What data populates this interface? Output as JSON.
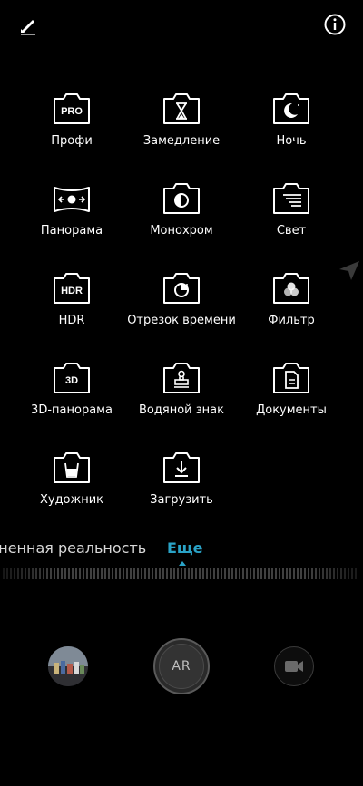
{
  "top_bar": {
    "edit_icon": "pencil-icon",
    "info_icon": "info-icon"
  },
  "modes": [
    {
      "label": "Профи",
      "icon": "pro-icon"
    },
    {
      "label": "Замедление",
      "icon": "hourglass-icon"
    },
    {
      "label": "Ночь",
      "icon": "night-icon"
    },
    {
      "label": "Панорама",
      "icon": "panorama-icon"
    },
    {
      "label": "Монохром",
      "icon": "monochrome-icon"
    },
    {
      "label": "Свет",
      "icon": "light-painting-icon"
    },
    {
      "label": "HDR",
      "icon": "hdr-icon"
    },
    {
      "label": "Отрезок времени",
      "icon": "timelapse-icon"
    },
    {
      "label": "Фильтр",
      "icon": "filter-icon"
    },
    {
      "label": "3D-панорама",
      "icon": "3d-panorama-icon"
    },
    {
      "label": "Водяной знак",
      "icon": "watermark-icon"
    },
    {
      "label": "Документы",
      "icon": "documents-icon"
    },
    {
      "label": "Художник",
      "icon": "artist-icon"
    },
    {
      "label": "Загрузить",
      "icon": "download-icon"
    }
  ],
  "mode_switcher": {
    "previous": "Дополненная реальность",
    "previous_visible": "лненная реальность",
    "current": "Еще",
    "accent_color": "#2aa3c7"
  },
  "bottom": {
    "shutter_label": "AR",
    "gallery_icon": "gallery-thumbnail",
    "video_icon": "video-camera-icon"
  }
}
